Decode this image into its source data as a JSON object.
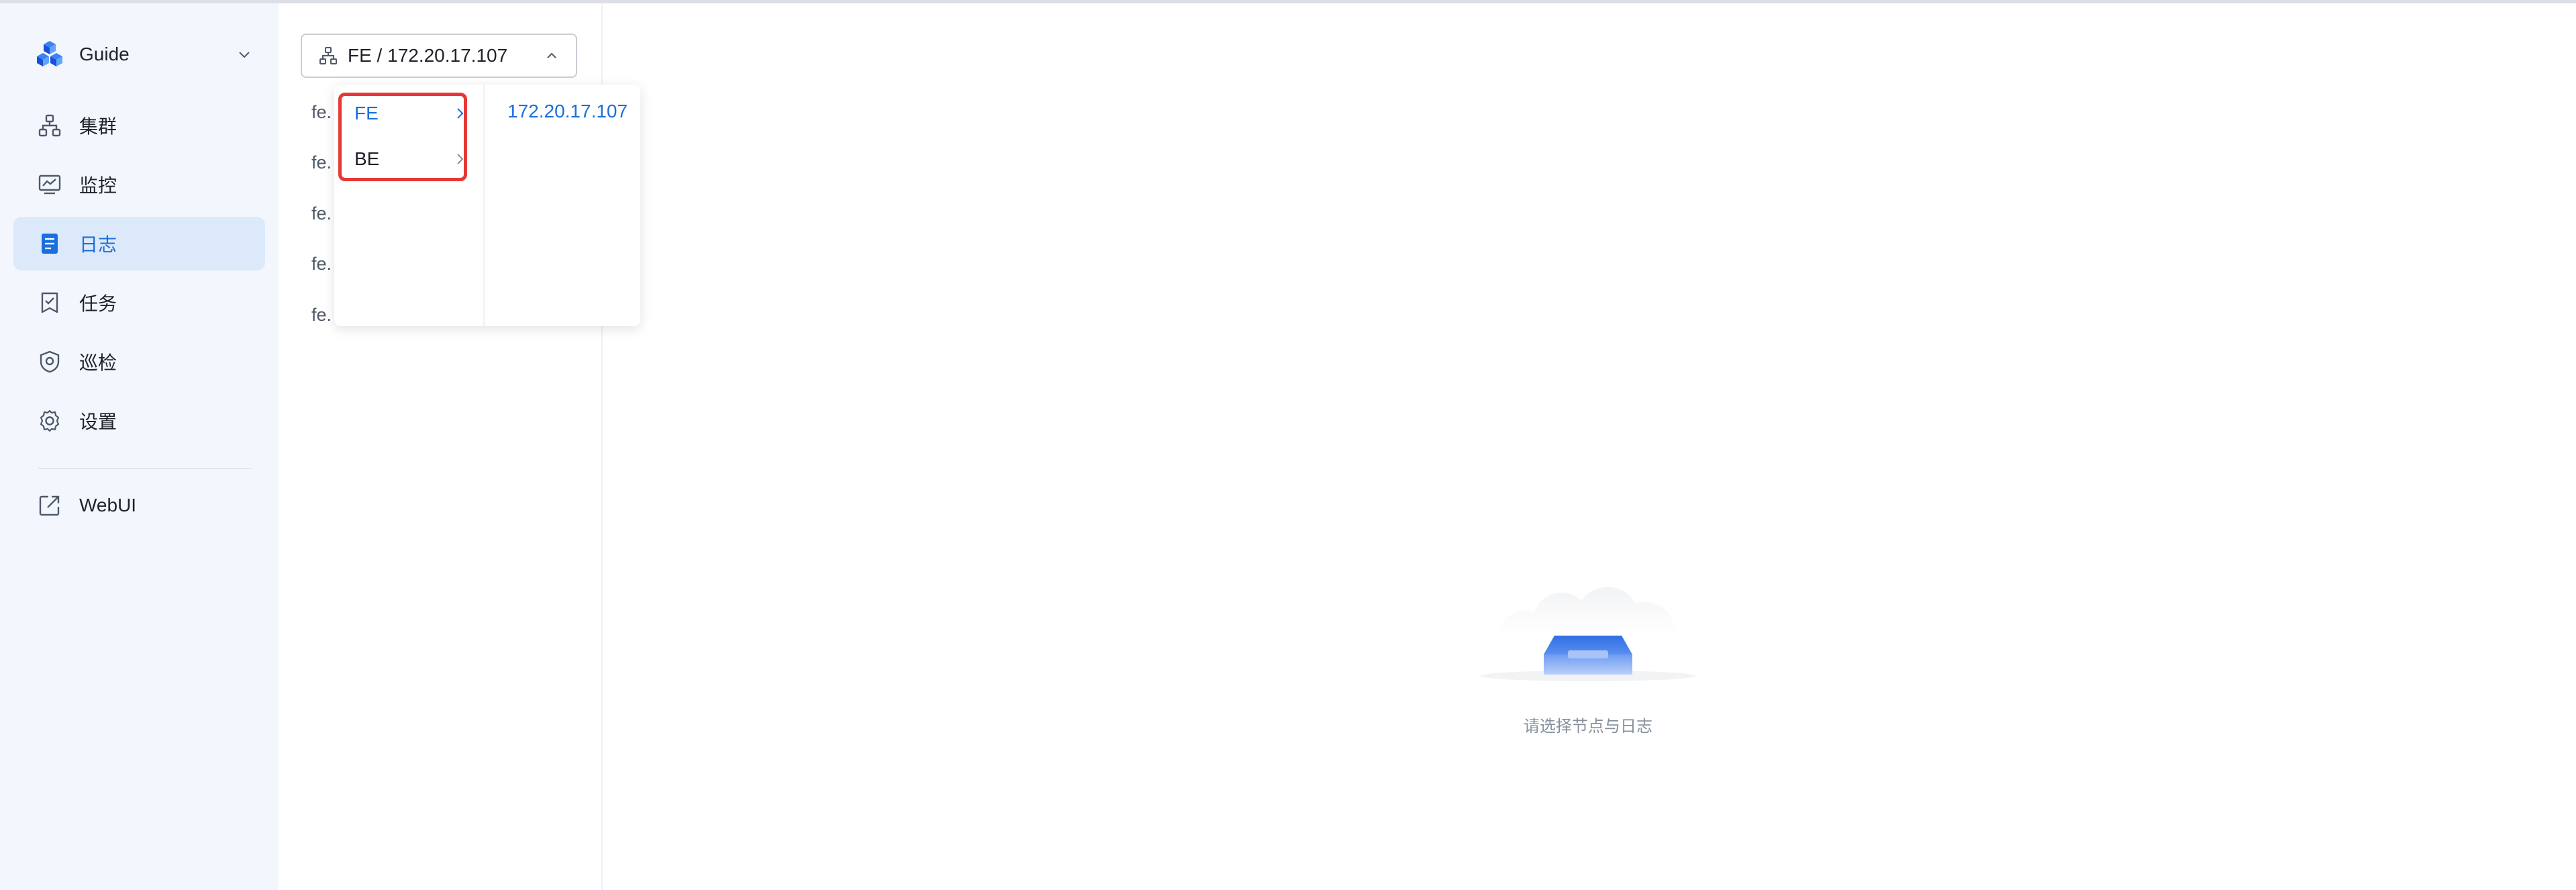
{
  "sidebar": {
    "brand": {
      "name": "Guide",
      "logo_icon": "cubes-logo-icon",
      "chevron_icon": "chevron-down-icon"
    },
    "items": [
      {
        "id": "cluster",
        "label": "集群",
        "icon": "cluster-icon",
        "active": false
      },
      {
        "id": "monitor",
        "label": "监控",
        "icon": "monitor-icon",
        "active": false
      },
      {
        "id": "logs",
        "label": "日志",
        "icon": "document-icon",
        "active": true
      },
      {
        "id": "tasks",
        "label": "任务",
        "icon": "task-icon",
        "active": false
      },
      {
        "id": "inspection",
        "label": "巡检",
        "icon": "shield-icon",
        "active": false
      },
      {
        "id": "settings",
        "label": "设置",
        "icon": "gear-icon",
        "active": false
      }
    ],
    "external": {
      "label": "WebUI",
      "icon": "external-link-icon"
    }
  },
  "node_selector": {
    "value": "FE / 172.20.17.107",
    "icon": "cluster-icon",
    "chevron_icon": "chevron-up-icon"
  },
  "log_list": [
    "fe.",
    "fe.",
    "fe.",
    "fe.",
    "fe."
  ],
  "cascader": {
    "level1": [
      {
        "label": "FE",
        "selected": true
      },
      {
        "label": "BE",
        "selected": false
      }
    ],
    "level2": [
      {
        "label": "172.20.17.107",
        "selected": true
      }
    ]
  },
  "empty_state": {
    "icon": "empty-inbox-icon",
    "text": "请选择节点与日志"
  },
  "colors": {
    "accent": "#1a6fdc",
    "sidebar_bg": "#f3f7fd",
    "active_bg": "#dce9fb",
    "highlight_border": "#e53935"
  }
}
